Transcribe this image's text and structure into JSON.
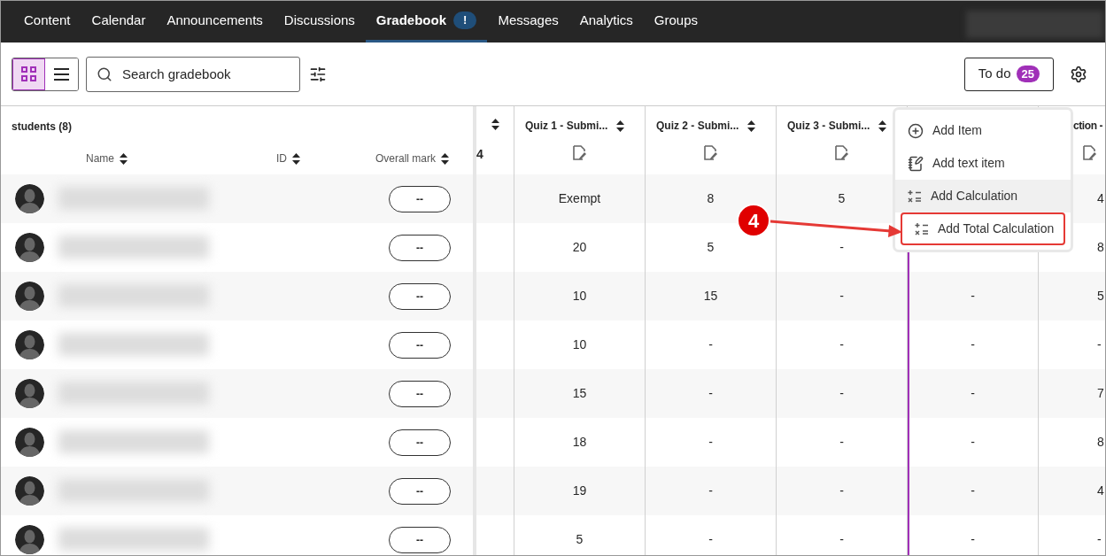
{
  "nav": {
    "tabs": [
      {
        "label": "Content",
        "selected": false
      },
      {
        "label": "Calendar",
        "selected": false
      },
      {
        "label": "Announcements",
        "selected": false
      },
      {
        "label": "Discussions",
        "selected": false
      },
      {
        "label": "Gradebook",
        "selected": true,
        "badge": "!"
      },
      {
        "label": "Messages",
        "selected": false
      },
      {
        "label": "Analytics",
        "selected": false
      },
      {
        "label": "Groups",
        "selected": false
      }
    ]
  },
  "toolbar": {
    "views": [
      {
        "kind": "grid",
        "selected": true
      },
      {
        "kind": "list",
        "selected": false
      }
    ],
    "search": {
      "placeholder": "Search gradebook"
    },
    "todo": {
      "label": "To do",
      "count": "25"
    }
  },
  "students_panel": {
    "title": "students (8)",
    "columns": [
      "Name",
      "ID",
      "Overall mark"
    ]
  },
  "students": [
    {
      "overall_mark": "--"
    },
    {
      "overall_mark": "--"
    },
    {
      "overall_mark": "--"
    },
    {
      "overall_mark": "--"
    },
    {
      "overall_mark": "--"
    },
    {
      "overall_mark": "--"
    },
    {
      "overall_mark": "--"
    },
    {
      "overall_mark": "--"
    }
  ],
  "grade_columns": [
    {
      "kind": "partial",
      "header_text": "4"
    },
    {
      "kind": "item",
      "title": "Quiz 1 - Submi...",
      "values": [
        "Exempt",
        "20",
        "10",
        "10",
        "15",
        "18",
        "19",
        "5"
      ]
    },
    {
      "kind": "item",
      "title": "Quiz 2 - Submi...",
      "values": [
        "8",
        "5",
        "15",
        "-",
        "-",
        "-",
        "-",
        "-"
      ]
    },
    {
      "kind": "item",
      "title": "Quiz 3 - Submi...",
      "values": [
        "5",
        "-",
        "-",
        "-",
        "-",
        "-",
        "-",
        "-"
      ]
    },
    {
      "kind": "covered",
      "values": [
        "-",
        "-",
        "-",
        "-",
        "-",
        "-"
      ]
    },
    {
      "kind": "item",
      "title": "ction -",
      "values": [
        "4",
        "8",
        "5",
        "-",
        "7",
        "8",
        "4",
        "-"
      ]
    }
  ],
  "add_menu": {
    "items": [
      {
        "kind": "add",
        "label": "Add Item",
        "hovered": false,
        "annotated": false
      },
      {
        "kind": "text",
        "label": "Add text item",
        "hovered": false,
        "annotated": false
      },
      {
        "kind": "calc",
        "label": "Add Calculation",
        "hovered": true,
        "annotated": false
      },
      {
        "kind": "calc",
        "label": "Add Total Calculation",
        "hovered": false,
        "annotated": true
      }
    ]
  },
  "callout": {
    "label": "4"
  }
}
